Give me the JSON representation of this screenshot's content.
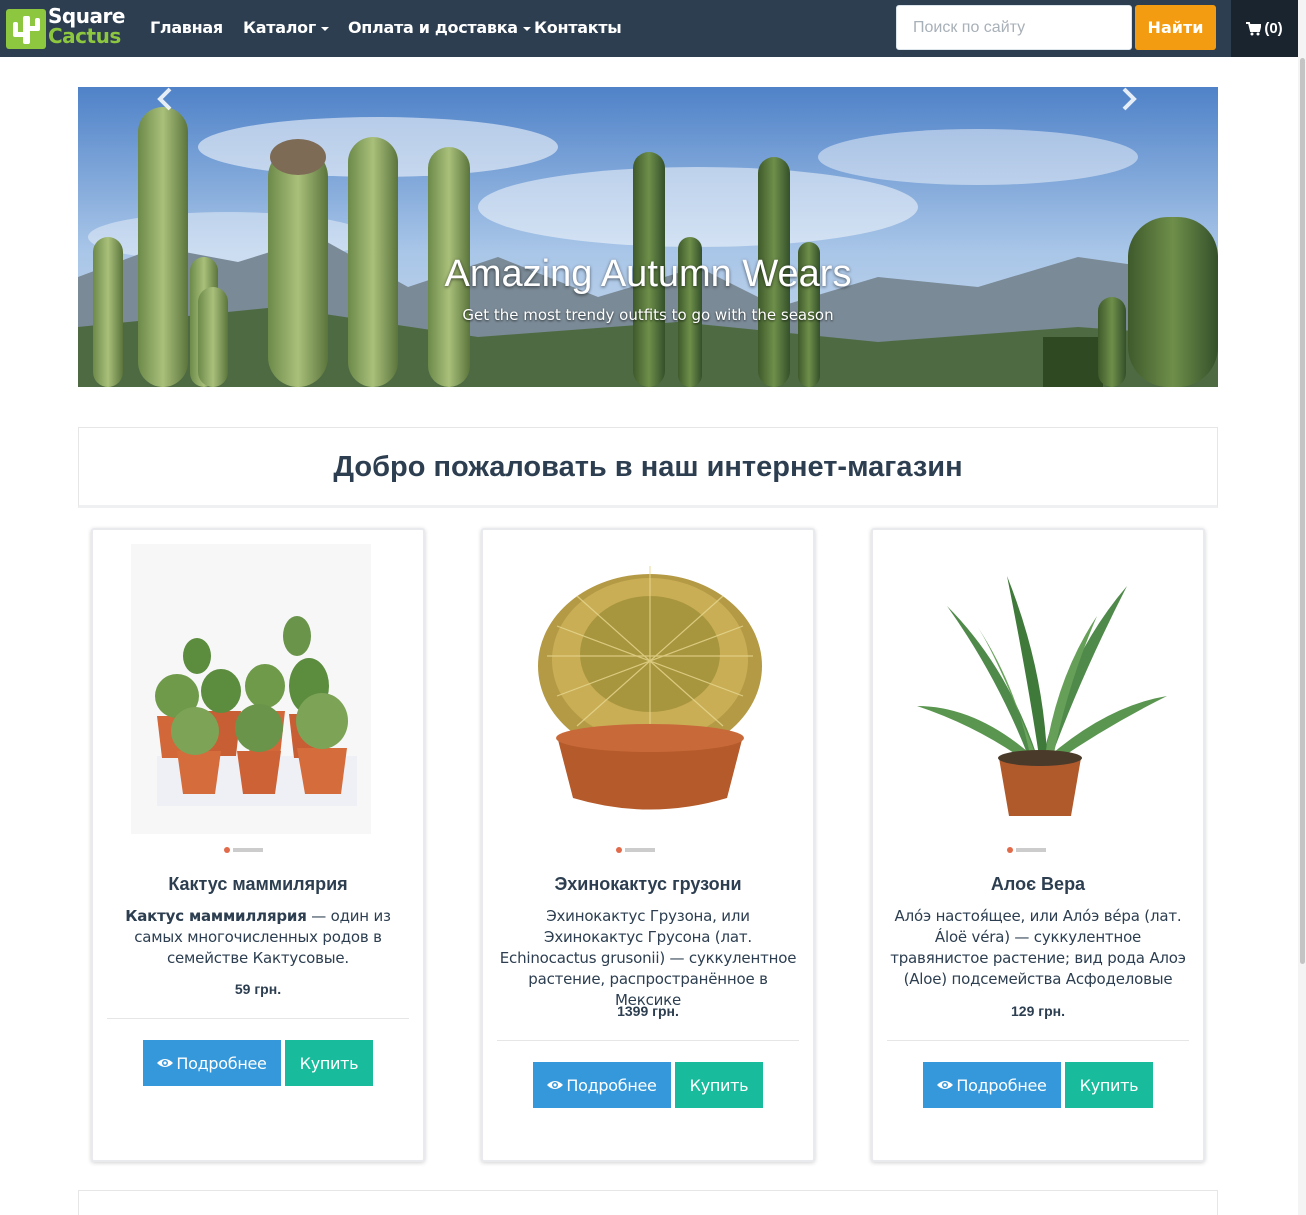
{
  "brand": {
    "line1": "Square",
    "line2": "Cactus",
    "color_green": "#8dc63f"
  },
  "nav": {
    "items": [
      {
        "label": "Главная",
        "dropdown": false
      },
      {
        "label": "Каталог",
        "dropdown": true
      },
      {
        "label": "Оплата и доставка",
        "dropdown": true
      },
      {
        "label": "Контакты",
        "dropdown": false
      }
    ],
    "search_placeholder": "Поиск по сайту",
    "search_button": "Найти",
    "cart_label": "(0)",
    "cart_icon": "shopping-cart-icon"
  },
  "carousel": {
    "title": "Amazing Autumn Wears",
    "subtitle": "Get the most trendy outfits to go with the season",
    "prev_icon": "chevron-left-icon",
    "next_icon": "chevron-right-icon"
  },
  "welcome": {
    "title": "Добро пожаловать в наш интернет-магазин"
  },
  "products": [
    {
      "title": "Кактус маммилярия",
      "desc_bold": "Кактус маммиллярия",
      "desc": " — один из самых многочисленных родов в семействе Кактусовые.",
      "price": "59 грн.",
      "more_label": "Подробнее",
      "buy_label": "Купить"
    },
    {
      "title": "Эхинокактус грузони",
      "desc_bold": "",
      "desc": "Эхинокактус Грузона, или Эхинокактус Грусона (лат. Echinocactus grusonii) — суккулентное растение, распространённое в Мексике",
      "price": "1399 грн.",
      "more_label": "Подробнее",
      "buy_label": "Купить"
    },
    {
      "title": "Алоє Вера",
      "desc_bold": "",
      "desc": "Ало́э настоя́щее, или Ало́э ве́ра (лат. Áloë véra) — суккулентное травянистое растение; вид рода Алоэ (Aloe) подсемейства Асфоделовые",
      "price": "129 грн.",
      "more_label": "Подробнее",
      "buy_label": "Купить"
    }
  ],
  "colors": {
    "navbar": "#2c3e50",
    "search_button": "#f39c12",
    "more_button": "#3498db",
    "buy_button": "#18bc9c"
  }
}
